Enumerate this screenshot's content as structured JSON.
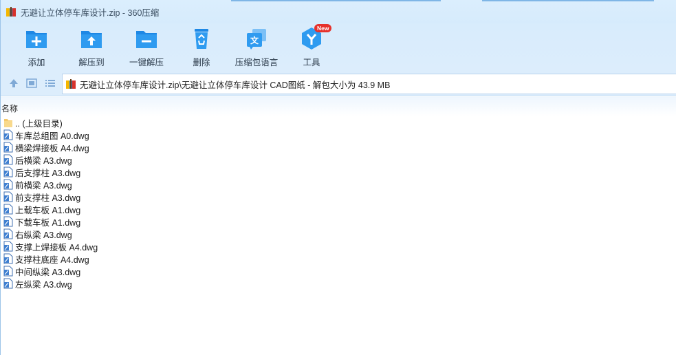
{
  "window": {
    "title": "无避让立体停车库设计.zip - 360压缩"
  },
  "toolbar": {
    "items": [
      {
        "label": "添加",
        "icon": "add-folder-icon"
      },
      {
        "label": "解压到",
        "icon": "extract-to-icon"
      },
      {
        "label": "一键解压",
        "icon": "one-click-extract-icon"
      },
      {
        "label": "删除",
        "icon": "recycle-bin-icon"
      },
      {
        "label": "压缩包语言",
        "icon": "language-icon"
      },
      {
        "label": "工具",
        "icon": "tools-icon",
        "badge": "New"
      }
    ]
  },
  "address": {
    "path": "无避让立体停车库设计.zip\\无避让立体停车库设计 CAD图纸 - 解包大小为 43.9 MB"
  },
  "list": {
    "header_name": "名称",
    "parent": ".. (上级目录)",
    "files": [
      "车库总组图 A0.dwg",
      "横梁焊接板 A4.dwg",
      "后横梁 A3.dwg",
      "后支撑柱 A3.dwg",
      "前横梁 A3.dwg",
      "前支撑柱 A3.dwg",
      "上载车板 A1.dwg",
      "下载车板 A1.dwg",
      "右纵梁 A3.dwg",
      "支撑上焊接板 A4.dwg",
      "支撑柱底座 A4.dwg",
      "中间纵梁 A3.dwg",
      "左纵梁 A3.dwg"
    ]
  },
  "colors": {
    "accent": "#2e8fe0",
    "toolbar_bg": "#d8ecfc",
    "badge": "#e6322c"
  }
}
